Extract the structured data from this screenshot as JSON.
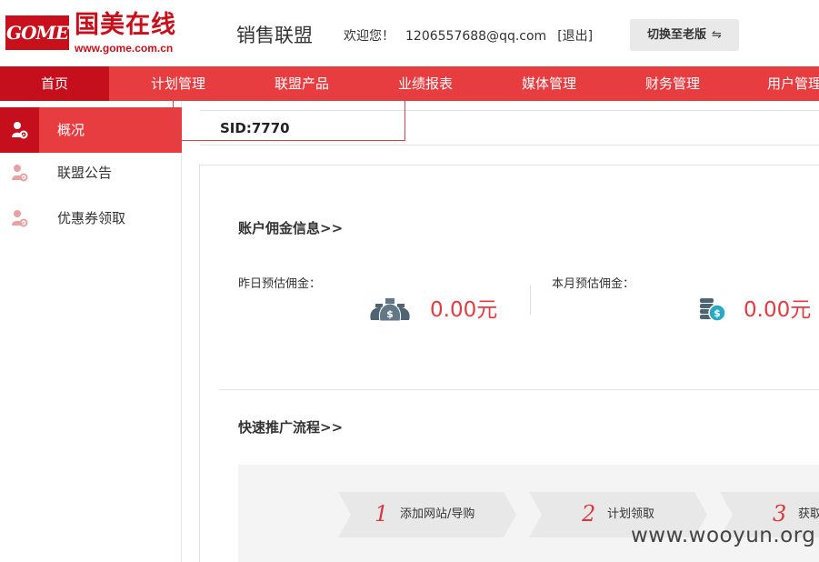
{
  "header": {
    "logo_mark": "GOME",
    "logo_cn": "国美在线",
    "logo_url": "www.gome.com.cn",
    "site_title": "销售联盟",
    "welcome": "欢迎您！",
    "email": "1206557688@qq.com",
    "logout": "[退出]",
    "switch_label": "切换至老版",
    "switch_arrows": "⇋"
  },
  "nav": {
    "items": [
      {
        "label": "首页"
      },
      {
        "label": "计划管理"
      },
      {
        "label": "联盟产品"
      },
      {
        "label": "业绩报表"
      },
      {
        "label": "媒体管理"
      },
      {
        "label": "财务管理"
      },
      {
        "label": "用户管理"
      }
    ]
  },
  "sidebar": {
    "items": [
      {
        "label": "概况"
      },
      {
        "label": "联盟公告"
      },
      {
        "label": "优惠券领取"
      }
    ]
  },
  "sid": "SID:7770",
  "commission": {
    "title": "账户佣金信息>>",
    "yesterday_label": "昨日预估佣金：",
    "yesterday_value": "0.00元",
    "month_label": "本月预估佣金：",
    "month_value": "0.00元"
  },
  "flow": {
    "title": "快速推广流程>>",
    "steps": [
      {
        "num": "1",
        "label": "添加网站/导购"
      },
      {
        "num": "2",
        "label": "计划领取"
      },
      {
        "num": "3",
        "label": "获取"
      }
    ]
  },
  "watermark": "www.wooyun.org",
  "colors": {
    "brand_red": "#e73d41",
    "dark_red": "#c50f1d",
    "amount_red": "#e33b3f"
  }
}
